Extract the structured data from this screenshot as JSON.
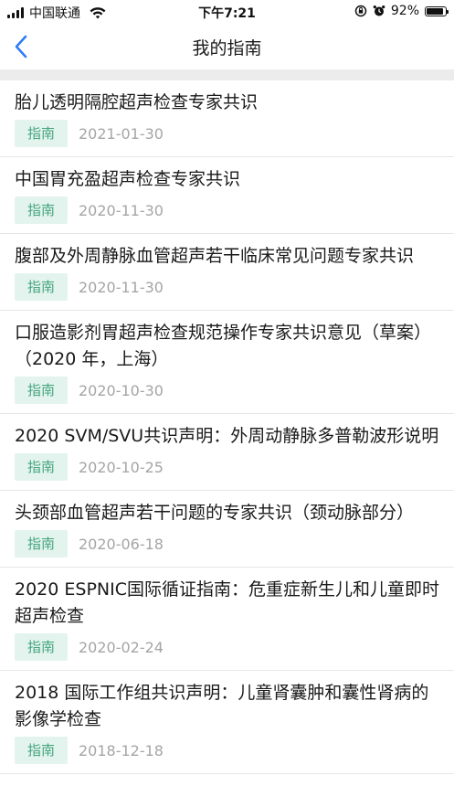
{
  "status_bar": {
    "carrier": "中国联通",
    "time": "下午7:21",
    "battery_percent": "92%",
    "battery_level": 0.92
  },
  "nav": {
    "title": "我的指南",
    "back_icon": "chevron-left-icon"
  },
  "colors": {
    "accent_blue": "#2f7cf6",
    "tag_bg": "#e3f4ee",
    "tag_text": "#45a57f",
    "date_text": "#a5a5a5"
  },
  "guides": [
    {
      "title": "胎儿透明隔腔超声检查专家共识",
      "tag": "指南",
      "date": "2021-01-30"
    },
    {
      "title": "中国胃充盈超声检查专家共识",
      "tag": "指南",
      "date": "2020-11-30"
    },
    {
      "title": "腹部及外周静脉血管超声若干临床常见问题专家共识",
      "tag": "指南",
      "date": "2020-11-30"
    },
    {
      "title": "口服造影剂胃超声检查规范操作专家共识意见（草案）（2020 年，上海）",
      "tag": "指南",
      "date": "2020-10-30"
    },
    {
      "title": "2020 SVM/SVU共识声明：外周动静脉多普勒波形说明",
      "tag": "指南",
      "date": "2020-10-25"
    },
    {
      "title": "头颈部血管超声若干问题的专家共识（颈动脉部分）",
      "tag": "指南",
      "date": "2020-06-18"
    },
    {
      "title": "2020 ESPNIC国际循证指南：危重症新生儿和儿童即时超声检查",
      "tag": "指南",
      "date": "2020-02-24"
    },
    {
      "title": "2018 国际工作组共识声明：儿童肾囊肿和囊性肾病的影像学检查",
      "tag": "指南",
      "date": "2018-12-18"
    }
  ]
}
